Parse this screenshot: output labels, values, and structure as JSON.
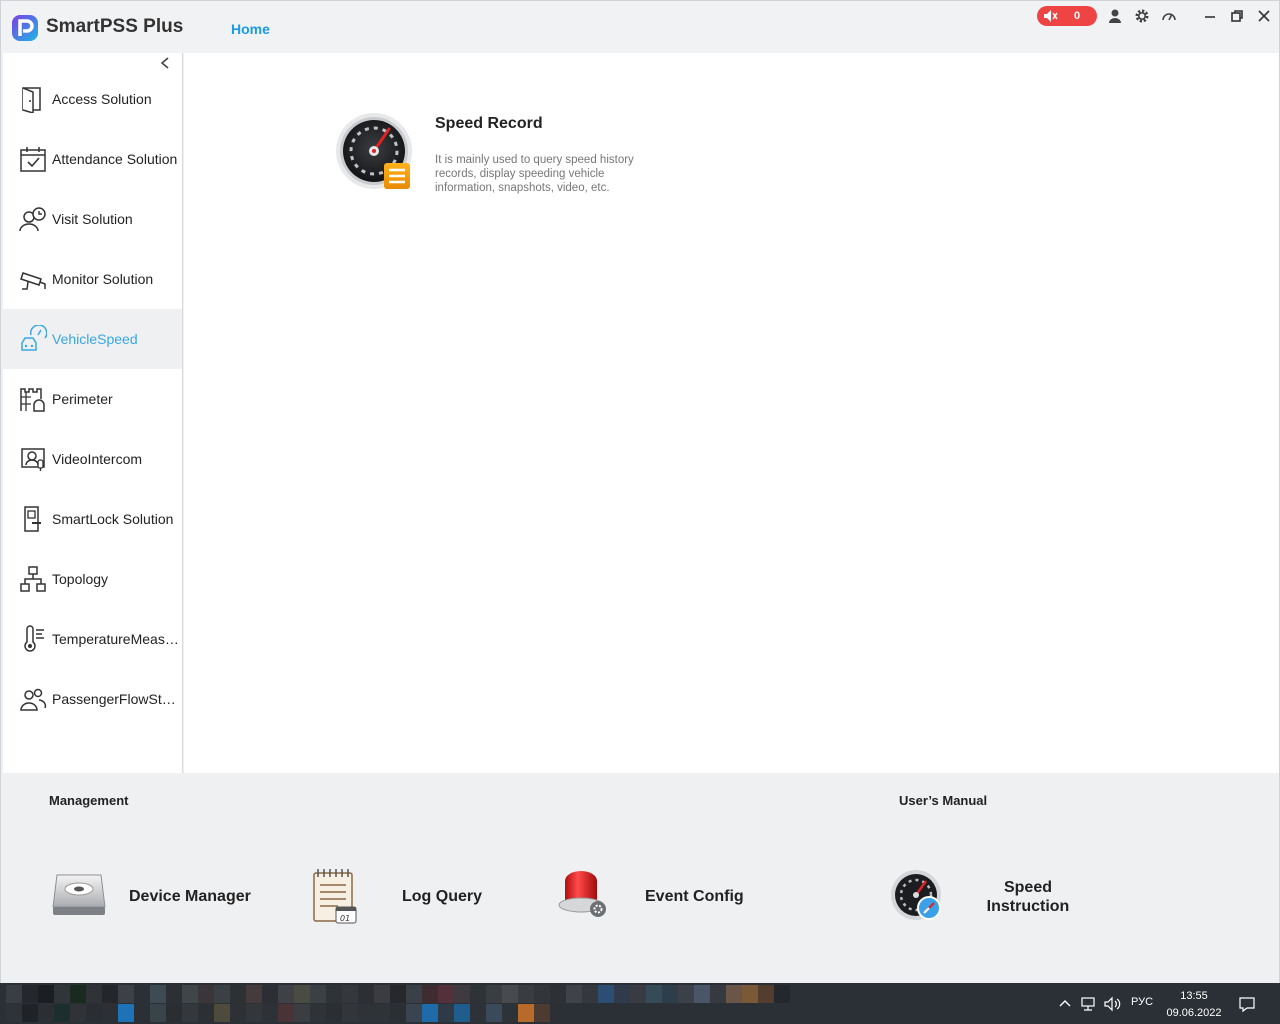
{
  "app": {
    "title": "SmartPSS Plus",
    "home_tab": "Home"
  },
  "alarm": {
    "count": "0"
  },
  "sidebar": {
    "items": [
      {
        "label": "Access Solution",
        "icon": "door-icon"
      },
      {
        "label": "Attendance Solution",
        "icon": "calendar-check-icon"
      },
      {
        "label": "Visit Solution",
        "icon": "visitor-clock-icon"
      },
      {
        "label": "Monitor Solution",
        "icon": "cctv-camera-icon"
      },
      {
        "label": "VehicleSpeed",
        "icon": "vehicle-speed-icon",
        "active": true
      },
      {
        "label": "Perimeter",
        "icon": "perimeter-alarm-icon"
      },
      {
        "label": "VideoIntercom",
        "icon": "intercom-icon"
      },
      {
        "label": "SmartLock Solution",
        "icon": "smart-lock-icon"
      },
      {
        "label": "Topology",
        "icon": "topology-icon"
      },
      {
        "label": "TemperatureMeas…",
        "icon": "thermometer-icon"
      },
      {
        "label": "PassengerFlowSt…",
        "icon": "people-icon"
      }
    ]
  },
  "content": {
    "card": {
      "title": "Speed Record",
      "description": "It is mainly used to query speed history records, display speeding vehicle information, snapshots, video, etc."
    }
  },
  "bottom": {
    "management_title": "Management",
    "manual_title": "User’s Manual",
    "tools": [
      {
        "label": "Device Manager",
        "icon": "device-manager-icon"
      },
      {
        "label": "Log Query",
        "icon": "log-notebook-icon"
      },
      {
        "label": "Event Config",
        "icon": "alarm-siren-icon"
      }
    ],
    "manual": {
      "line1": "Speed",
      "line2": "Instruction",
      "icon": "speedometer-compass-icon"
    }
  },
  "taskbar": {
    "language": "РУС",
    "time": "13:55",
    "date": "09.06.2022"
  },
  "colors": {
    "accent": "#1a9be6",
    "alarm": "#ee4444",
    "active_item_text": "#3aa7e3"
  }
}
